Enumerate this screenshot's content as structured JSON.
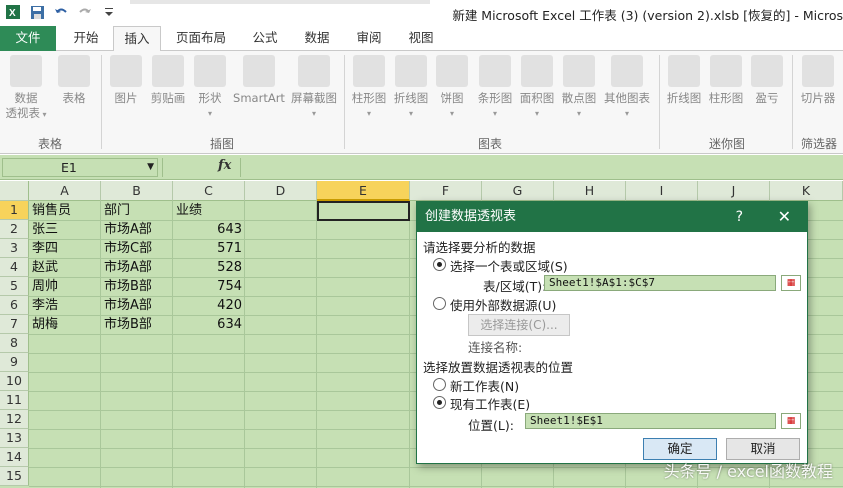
{
  "window": {
    "title": "新建 Microsoft Excel 工作表 (3) (version 2).xlsb [恢复的] - Micros"
  },
  "qat": {
    "icons": [
      "excel-icon",
      "save-icon",
      "undo-icon",
      "redo-icon",
      "customize-icon"
    ]
  },
  "tabs": [
    {
      "label": "文件"
    },
    {
      "label": "开始"
    },
    {
      "label": "插入"
    },
    {
      "label": "页面布局"
    },
    {
      "label": "公式"
    },
    {
      "label": "数据"
    },
    {
      "label": "审阅"
    },
    {
      "label": "视图"
    }
  ],
  "ribbon": {
    "buttons": [
      {
        "label": "数据",
        "label2": "透视表"
      },
      {
        "label": "表格"
      },
      {
        "label": "图片"
      },
      {
        "label": "剪贴画"
      },
      {
        "label": "形状"
      },
      {
        "label": "SmartArt"
      },
      {
        "label": "屏幕截图"
      },
      {
        "label": "柱形图"
      },
      {
        "label": "折线图"
      },
      {
        "label": "饼图"
      },
      {
        "label": "条形图"
      },
      {
        "label": "面积图"
      },
      {
        "label": "散点图"
      },
      {
        "label": "其他图表"
      },
      {
        "label": "折线图"
      },
      {
        "label": "柱形图"
      },
      {
        "label": "盈亏"
      },
      {
        "label": "切片器"
      }
    ],
    "groups": [
      "表格",
      "插图",
      "图表",
      "迷你图",
      "筛选器"
    ]
  },
  "formula_bar": {
    "name_box": "E1",
    "fx": "fx",
    "value": ""
  },
  "grid": {
    "columns": [
      "A",
      "B",
      "C",
      "D",
      "E",
      "F",
      "G",
      "H",
      "I",
      "J",
      "K"
    ],
    "rows": [
      "1",
      "2",
      "3",
      "4",
      "5",
      "6",
      "7",
      "8",
      "9",
      "10",
      "11",
      "12",
      "13",
      "14",
      "15"
    ],
    "headers": [
      "销售员",
      "部门",
      "业绩"
    ],
    "data": [
      [
        "张三",
        "市场A部",
        "643"
      ],
      [
        "李四",
        "市场C部",
        "571"
      ],
      [
        "赵武",
        "市场A部",
        "528"
      ],
      [
        "周帅",
        "市场B部",
        "754"
      ],
      [
        "李浩",
        "市场A部",
        "420"
      ],
      [
        "胡梅",
        "市场B部",
        "634"
      ]
    ],
    "selected_cell": "E1"
  },
  "dialog": {
    "title": "创建数据透视表",
    "help": "?",
    "close": "✕",
    "section1": "请选择要分析的数据",
    "opt_table": "选择一个表或区域(S)",
    "range_label": "表/区域(T):",
    "range_value": "Sheet1!$A$1:$C$7",
    "opt_external": "使用外部数据源(U)",
    "choose_conn": "选择连接(C)...",
    "conn_name_label": "连接名称:",
    "section2": "选择放置数据透视表的位置",
    "opt_new_sheet": "新工作表(N)",
    "opt_existing": "现有工作表(E)",
    "location_label": "位置(L):",
    "location_value": "Sheet1!$E$1",
    "ok": "确定",
    "cancel": "取消"
  },
  "watermark": "头条号 / excel函数教程",
  "colors": {
    "accent": "#217346",
    "grid_bg": "#c6e0b4",
    "selected_header": "#f7d35b"
  }
}
